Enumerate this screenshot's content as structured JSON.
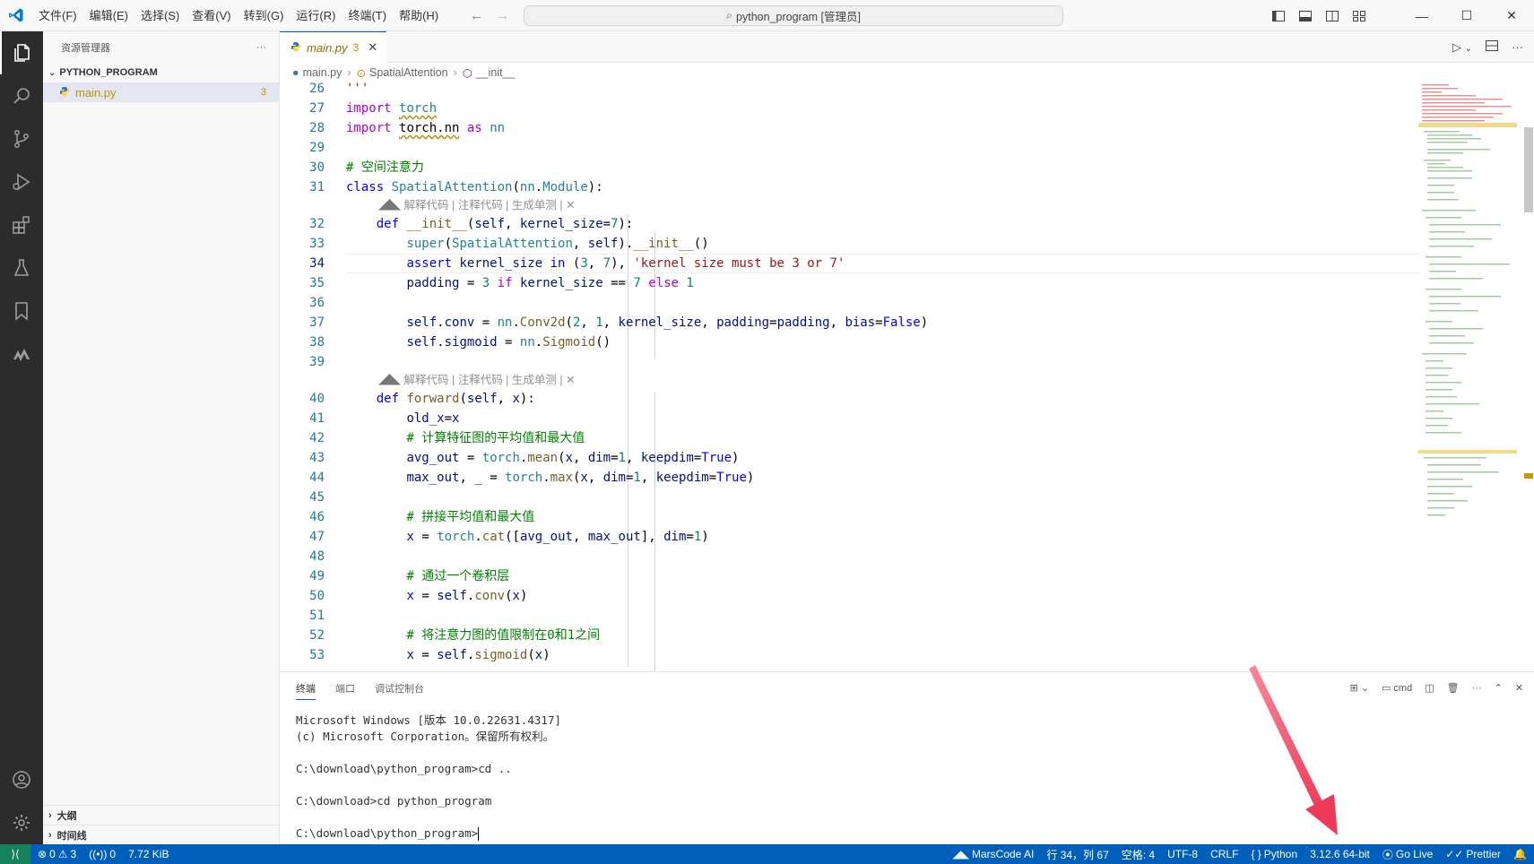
{
  "titlebar": {
    "menu": [
      "文件(F)",
      "编辑(E)",
      "选择(S)",
      "查看(V)",
      "转到(G)",
      "运行(R)",
      "终端(T)",
      "帮助(H)"
    ],
    "search_text": "python_program [管理员]"
  },
  "sidebar": {
    "title": "资源管理器",
    "more": "···",
    "folder": "PYTHON_PROGRAM",
    "file": "main.py",
    "file_problems": "3",
    "outline": "大纲",
    "timeline": "时间线"
  },
  "editor": {
    "tab_name": "main.py",
    "tab_problems": "3",
    "breadcrumb": [
      "main.py",
      "SpatialAttention",
      "__init__"
    ],
    "codelens": "解释代码 | 注释代码 | 生成单测 | ✕",
    "current_line": 34
  },
  "panel": {
    "tabs": [
      "终端",
      "端口",
      "调试控制台"
    ],
    "shell": "cmd",
    "terminal_lines": [
      "Microsoft Windows [版本 10.0.22631.4317]",
      "(c) Microsoft Corporation。保留所有权利。",
      "",
      "C:\\download\\python_program>cd ..",
      "",
      "C:\\download>cd python_program",
      "",
      "C:\\download\\python_program>"
    ]
  },
  "statusbar": {
    "errors": "0",
    "warnings": "3",
    "ports": "0",
    "filesize": "7.72 KiB",
    "marscode": "MarsCode AI",
    "position": "行 34，列 67",
    "spaces": "空格: 4",
    "encoding": "UTF-8",
    "eol": "CRLF",
    "language": "Python",
    "interpreter": "3.12.6 64-bit",
    "golive": "Go Live",
    "prettier": "Prettier"
  },
  "colors": {
    "accent": "#005fb8",
    "activitybar": "#2c2c2c",
    "annotation_arrow": "#f0506e"
  }
}
